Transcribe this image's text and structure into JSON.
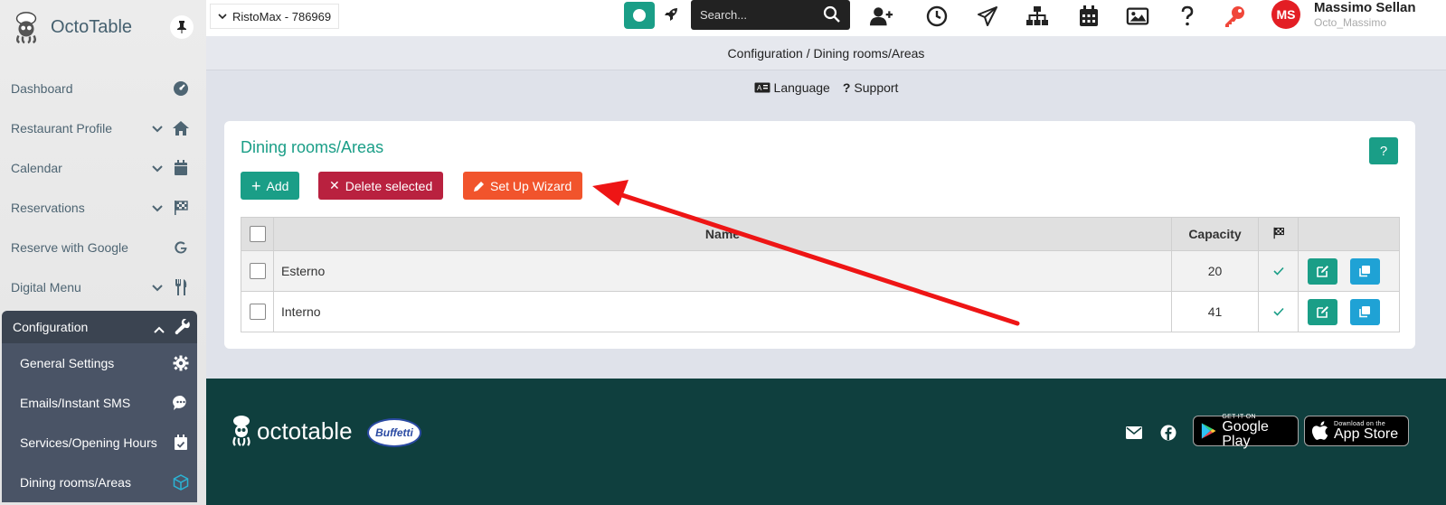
{
  "app": {
    "name": "OctoTable"
  },
  "sidebar": {
    "items": [
      {
        "label": "Dashboard",
        "icon": "dashboard-icon"
      },
      {
        "label": "Restaurant Profile",
        "icon": "home-icon"
      },
      {
        "label": "Calendar",
        "icon": "calendar-icon"
      },
      {
        "label": "Reservations",
        "icon": "checkered-flag-icon"
      },
      {
        "label": "Reserve with Google",
        "icon": "google-icon"
      },
      {
        "label": "Digital Menu",
        "icon": "utensils-icon"
      },
      {
        "label": "Configuration",
        "icon": "wrench-icon"
      }
    ],
    "subitems": [
      {
        "label": "General Settings",
        "icon": "gear-icon"
      },
      {
        "label": "Emails/Instant SMS",
        "icon": "chat-icon"
      },
      {
        "label": "Services/Opening Hours",
        "icon": "calendar-check-icon"
      },
      {
        "label": "Dining rooms/Areas",
        "icon": "cube-icon"
      }
    ]
  },
  "topbar": {
    "restaurant": "RistoMax - 786969",
    "search_placeholder": "Search...",
    "user": {
      "initials": "MS",
      "name": "Massimo Sellan",
      "handle": "Octo_Massimo"
    },
    "colors": {
      "accent": "#1a9e87",
      "avatar": "#e31e24"
    }
  },
  "breadcrumb": "Configuration / Dining rooms/Areas",
  "links": {
    "language": "Language",
    "support": "Support"
  },
  "card": {
    "title": "Dining rooms/Areas",
    "help": "?",
    "buttons": {
      "add": "Add",
      "delete": "Delete selected",
      "wizard": "Set Up Wizard"
    },
    "table": {
      "headers": {
        "name": "Name",
        "capacity": "Capacity"
      },
      "rows": [
        {
          "name": "Esterno",
          "capacity": "20",
          "active": true
        },
        {
          "name": "Interno",
          "capacity": "41",
          "active": true
        }
      ]
    }
  },
  "footer": {
    "logo_text": "octotable",
    "partner": "Buffetti",
    "google_play": {
      "small": "GET IT ON",
      "big": "Google Play"
    },
    "app_store": {
      "small": "Download on the",
      "big": "App Store"
    }
  }
}
